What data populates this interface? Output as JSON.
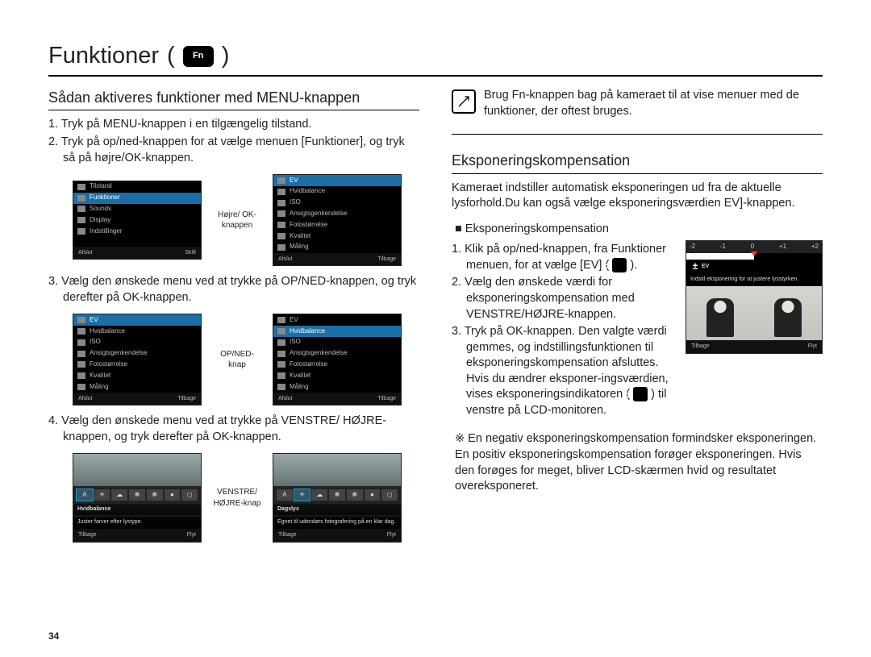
{
  "page_number": "34",
  "title": "Funktioner",
  "fn_badge": "Fn",
  "left": {
    "heading": "Sådan aktiveres funktioner med MENU-knappen",
    "steps": {
      "s1": "1. Tryk på MENU-knappen i en tilgængelig tilstand.",
      "s2": "2. Tryk på op/ned-knappen for at vælge menuen [Funktioner], og tryk så på højre/OK-knappen.",
      "s3": "3. Vælg den ønskede menu ved at trykke på OP/NED-knappen, og tryk derefter på OK-knappen.",
      "s4": "4. Vælg den ønskede menu ved at trykke på VENSTRE/ HØJRE-knappen, og tryk derefter på OK-knappen."
    },
    "btn_label_1": "Højre/ OK-knappen",
    "btn_label_2": "OP/NED-knap",
    "btn_label_3": "VENSTRE/ HØJRE-knap",
    "screen_a": {
      "items": [
        "Tilstand",
        "Funktioner",
        "Sounds",
        "Display",
        "Indstillinger"
      ],
      "right_items": [
        "EV",
        "Hvidbalance",
        "ISO",
        "Ansigtsgenkendelse",
        "Fotostørrelse",
        "Kvalitet",
        "Måling"
      ],
      "sel_index": 1,
      "footer_l": "Afslut",
      "footer_r": "Skift"
    },
    "screen_b": {
      "items": [
        "EV",
        "Hvidbalance",
        "ISO",
        "Ansigtsgenkendelse",
        "Fotostørrelse",
        "Kvalitet",
        "Måling"
      ],
      "sel_index": 0,
      "footer_l": "Afslut",
      "footer_r": "Tilbage"
    },
    "screen_c": {
      "items": [
        "EV",
        "Hvidbalance",
        "ISO",
        "Ansigtsgenkendelse",
        "Fotostørrelse",
        "Kvalitet",
        "Måling"
      ],
      "sel_index": 0,
      "footer_l": "Afslut",
      "footer_r": "Tilbage"
    },
    "screen_d": {
      "items": [
        "EV",
        "Hvidbalance",
        "ISO",
        "Ansigtsgenkendelse",
        "Fotostørrelse",
        "Kvalitet",
        "Måling"
      ],
      "sel_index": 1,
      "footer_l": "Afslut",
      "footer_r": "Tilbage"
    },
    "screen_e": {
      "caption_title": "Hvidbalance",
      "caption_desc": "Juster farver efter lystype.",
      "footer_l": "Tilbage",
      "footer_r": "Flyt"
    },
    "screen_f": {
      "caption_title": "Dagslys",
      "caption_desc": "Egnet til udendørs fotografering på en klar dag.",
      "footer_l": "Tilbage",
      "footer_r": "Flyt"
    }
  },
  "right": {
    "note": "Brug Fn-knappen bag på kameraet til at vise menuer med de funktioner, der oftest bruges.",
    "heading": "Eksponeringskompensation",
    "intro": "Kameraet indstiller automatisk eksponeringen ud fra de aktuelle lysforhold.Du kan også vælge eksponeringsværdien EV]-knappen.",
    "sub": "Eksponeringskompensation",
    "steps": {
      "s1a": "1. Klik på op/ned-knappen, fra Funktioner menuen, for at vælge [EV] ( ",
      "s1b": " ).",
      "s2": "2. Vælg den ønskede værdi for eksponeringskompensation med VENSTRE/HØJRE-knappen.",
      "s3a": "3. Tryk på OK-knappen. Den valgte værdi gemmes, og indstillingsfunktionen til eksponeringskompensation afsluttes. Hvis du ændrer eksponer-ingsværdien, vises eksponeringsindikatoren ( ",
      "s3b": " ) til venstre på LCD-monitoren."
    },
    "footnote": "※ En negativ eksponeringskompensation formindsker eksponeringen. En positiv eksponeringskompensation forøger eksponeringen. Hvis den forøges for meget, bliver LCD-skærmen hvid og resultatet overeksponeret.",
    "ev_screen": {
      "scale": [
        "-2",
        "-1",
        "0",
        "+1",
        "+2"
      ],
      "title": "EV",
      "desc": "Indstil eksponering for at justere lysstyrken.",
      "footer_l": "Tilbage",
      "footer_r": "Flyt"
    }
  }
}
